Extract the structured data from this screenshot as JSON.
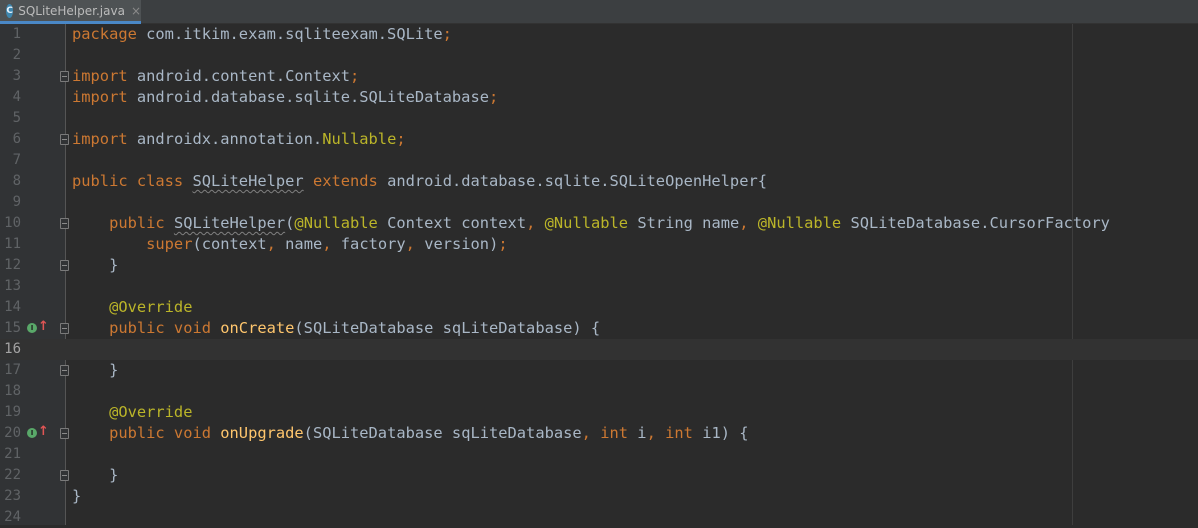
{
  "tab": {
    "icon_letter": "C",
    "label": "SQLiteHelper.java",
    "close": "×"
  },
  "gutter": {
    "run_glyph": "I",
    "override_glyph": "↑"
  },
  "lines": [
    {
      "num": "1",
      "tokens": [
        {
          "text": "package ",
          "kind": "kw"
        },
        {
          "text": "com.itkim.exam.sqliteexam.SQLite",
          "kind": "id"
        },
        {
          "text": ";",
          "kind": "kw"
        }
      ]
    },
    {
      "num": "2",
      "tokens": []
    },
    {
      "num": "3",
      "fold": true,
      "tokens": [
        {
          "text": "import ",
          "kind": "kw"
        },
        {
          "text": "android.content.Context",
          "kind": "id"
        },
        {
          "text": ";",
          "kind": "kw"
        }
      ]
    },
    {
      "num": "4",
      "tokens": [
        {
          "text": "import ",
          "kind": "kw"
        },
        {
          "text": "android.database.sqlite.SQLiteDatabase",
          "kind": "id"
        },
        {
          "text": ";",
          "kind": "kw"
        }
      ]
    },
    {
      "num": "5",
      "tokens": []
    },
    {
      "num": "6",
      "fold": true,
      "tokens": [
        {
          "text": "import ",
          "kind": "kw"
        },
        {
          "text": "androidx.annotation.",
          "kind": "id"
        },
        {
          "text": "Nullable",
          "kind": "an"
        },
        {
          "text": ";",
          "kind": "kw"
        }
      ]
    },
    {
      "num": "7",
      "tokens": []
    },
    {
      "num": "8",
      "tokens": [
        {
          "text": "public class ",
          "kind": "kw"
        },
        {
          "text": "SQLiteHelper",
          "kind": "wv"
        },
        {
          "text": " ",
          "kind": "id"
        },
        {
          "text": "extends ",
          "kind": "kw"
        },
        {
          "text": "android.database.sqlite.SQLiteOpenHelper{",
          "kind": "id"
        }
      ]
    },
    {
      "num": "9",
      "tokens": []
    },
    {
      "num": "10",
      "fold": true,
      "tokens": [
        {
          "text": "    public ",
          "kind": "kw"
        },
        {
          "text": "SQLiteHelper",
          "kind": "wv"
        },
        {
          "text": "(",
          "kind": "id"
        },
        {
          "text": "@Nullable ",
          "kind": "an"
        },
        {
          "text": "Context context",
          "kind": "id"
        },
        {
          "text": ", ",
          "kind": "kw"
        },
        {
          "text": "@Nullable ",
          "kind": "an"
        },
        {
          "text": "String name",
          "kind": "id"
        },
        {
          "text": ", ",
          "kind": "kw"
        },
        {
          "text": "@Nullable ",
          "kind": "an"
        },
        {
          "text": "SQLiteDatabase.CursorFactory",
          "kind": "id"
        }
      ]
    },
    {
      "num": "11",
      "tokens": [
        {
          "text": "        super",
          "kind": "kw"
        },
        {
          "text": "(context",
          "kind": "id"
        },
        {
          "text": ", ",
          "kind": "kw"
        },
        {
          "text": "name",
          "kind": "id"
        },
        {
          "text": ", ",
          "kind": "kw"
        },
        {
          "text": "factory",
          "kind": "id"
        },
        {
          "text": ", ",
          "kind": "kw"
        },
        {
          "text": "version)",
          "kind": "id"
        },
        {
          "text": ";",
          "kind": "kw"
        }
      ]
    },
    {
      "num": "12",
      "fold": true,
      "tokens": [
        {
          "text": "    }",
          "kind": "id"
        }
      ]
    },
    {
      "num": "13",
      "tokens": []
    },
    {
      "num": "14",
      "tokens": [
        {
          "text": "    @Override",
          "kind": "an"
        }
      ]
    },
    {
      "num": "15",
      "run": true,
      "override": true,
      "fold": true,
      "tokens": [
        {
          "text": "    public void ",
          "kind": "kw"
        },
        {
          "text": "onCreate",
          "kind": "fn"
        },
        {
          "text": "(SQLiteDatabase sqLiteDatabase) {",
          "kind": "id"
        }
      ]
    },
    {
      "num": "16",
      "current": true,
      "tokens": []
    },
    {
      "num": "17",
      "fold": true,
      "tokens": [
        {
          "text": "    }",
          "kind": "id"
        }
      ]
    },
    {
      "num": "18",
      "tokens": []
    },
    {
      "num": "19",
      "tokens": [
        {
          "text": "    @Override",
          "kind": "an"
        }
      ]
    },
    {
      "num": "20",
      "run": true,
      "override": true,
      "fold": true,
      "tokens": [
        {
          "text": "    public void ",
          "kind": "kw"
        },
        {
          "text": "onUpgrade",
          "kind": "fn"
        },
        {
          "text": "(SQLiteDatabase sqLiteDatabase",
          "kind": "id"
        },
        {
          "text": ", ",
          "kind": "kw"
        },
        {
          "text": "int ",
          "kind": "kw"
        },
        {
          "text": "i",
          "kind": "id"
        },
        {
          "text": ", ",
          "kind": "kw"
        },
        {
          "text": "int ",
          "kind": "kw"
        },
        {
          "text": "i1) {",
          "kind": "id"
        }
      ]
    },
    {
      "num": "21",
      "tokens": []
    },
    {
      "num": "22",
      "fold": true,
      "tokens": [
        {
          "text": "    }",
          "kind": "id"
        }
      ]
    },
    {
      "num": "23",
      "tokens": [
        {
          "text": "}",
          "kind": "id"
        }
      ]
    },
    {
      "num": "24",
      "tokens": []
    }
  ]
}
